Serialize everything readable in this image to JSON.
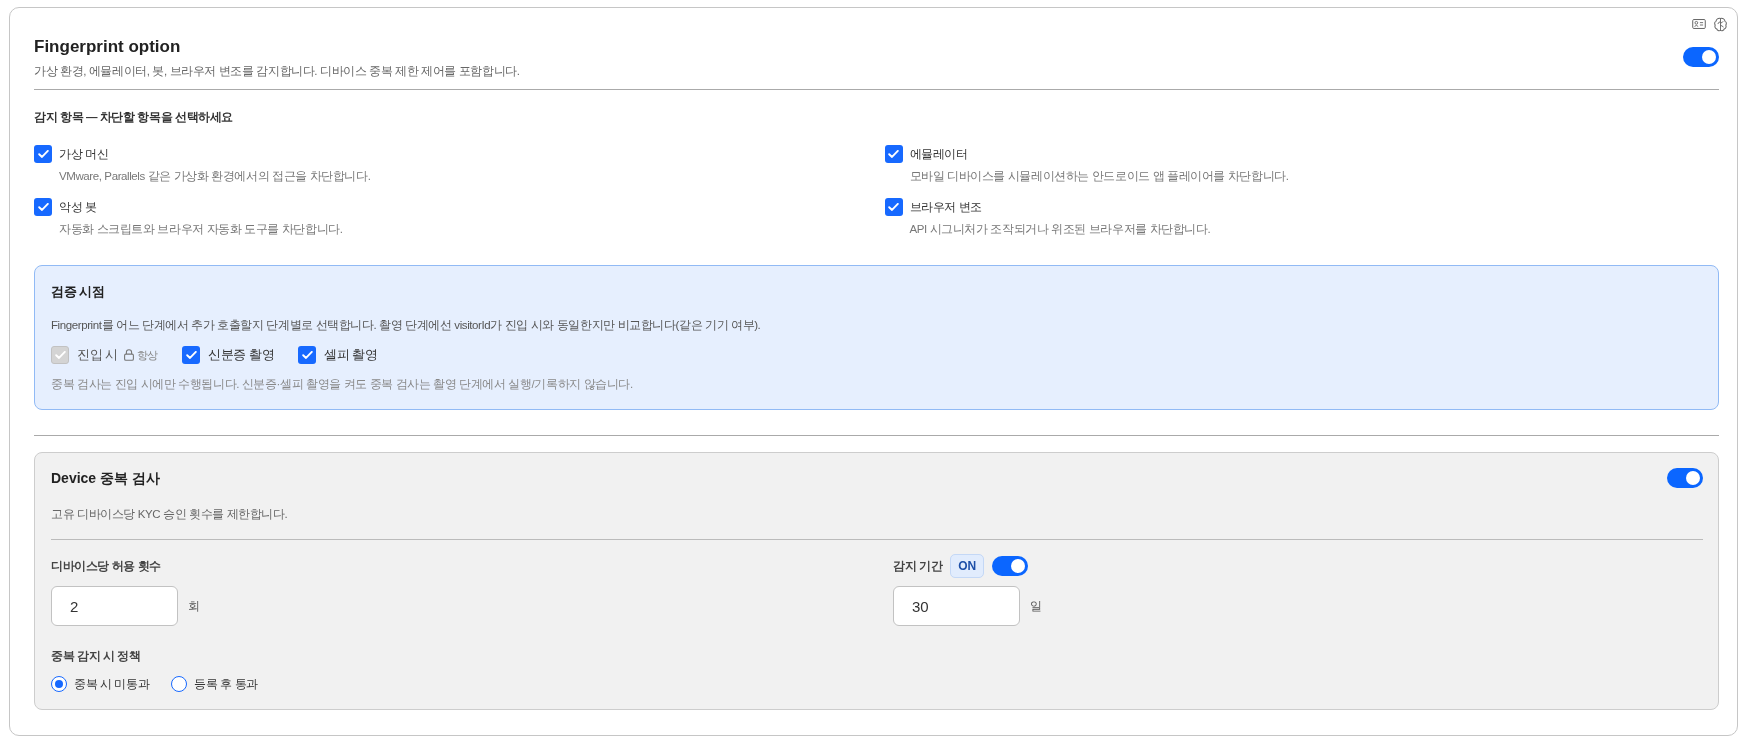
{
  "panel": {
    "title": "Fingerprint option",
    "description": "가상 환경, 에뮬레이터, 봇, 브라우저 변조를 감지합니다. 디바이스 중복 제한 제어를 포함합니다.",
    "enabled": true
  },
  "detection": {
    "heading": "감지 항목 — 차단할 항목을 선택하세요",
    "items": [
      {
        "label": "가상 머신",
        "description": "VMware, Parallels 같은 가상화 환경에서의 접근을 차단합니다.",
        "checked": true
      },
      {
        "label": "에뮬레이터",
        "description": "모바일 디바이스를 시뮬레이션하는 안드로이드 앱 플레이어를 차단합니다.",
        "checked": true
      },
      {
        "label": "악성 봇",
        "description": "자동화 스크립트와 브라우저 자동화 도구를 차단합니다.",
        "checked": true
      },
      {
        "label": "브라우저 변조",
        "description": "API 시그니처가 조작되거나 위조된 브라우저를 차단합니다.",
        "checked": true
      }
    ]
  },
  "verification_timing": {
    "title": "검증 시점",
    "description": "Fingerprint를 어느 단계에서 추가 호출할지 단계별로 선택합니다. 촬영 단계에선 visitorId가 진입 시와 동일한지만 비교합니다(같은 기기 여부).",
    "options": [
      {
        "label": "진입 시",
        "checked": true,
        "disabled": true,
        "locked_note": "항상"
      },
      {
        "label": "신분증 촬영",
        "checked": true,
        "disabled": false
      },
      {
        "label": "셀피 촬영",
        "checked": true,
        "disabled": false
      }
    ],
    "note": "중복 검사는 진입 시에만 수행됩니다. 신분증·셀피 촬영을 켜도 중복 검사는 촬영 단계에서 실행/기록하지 않습니다."
  },
  "device_duplicate_check": {
    "title": "Device 중복 검사",
    "enabled": true,
    "description": "고유 디바이스당 KYC 승인 횟수를 제한합니다.",
    "fields": [
      {
        "label": "디바이스당 허용 횟수",
        "value": "2",
        "unit": "회"
      },
      {
        "label": "감지 기간",
        "toggle": {
          "badge": "ON",
          "on": true
        },
        "value": "30",
        "unit": "일"
      }
    ],
    "policy": {
      "label": "중복 감지 시 정책",
      "options": [
        {
          "label": "중복 시 미통과",
          "selected": true
        },
        {
          "label": "등록 후 통과",
          "selected": false
        }
      ]
    }
  }
}
